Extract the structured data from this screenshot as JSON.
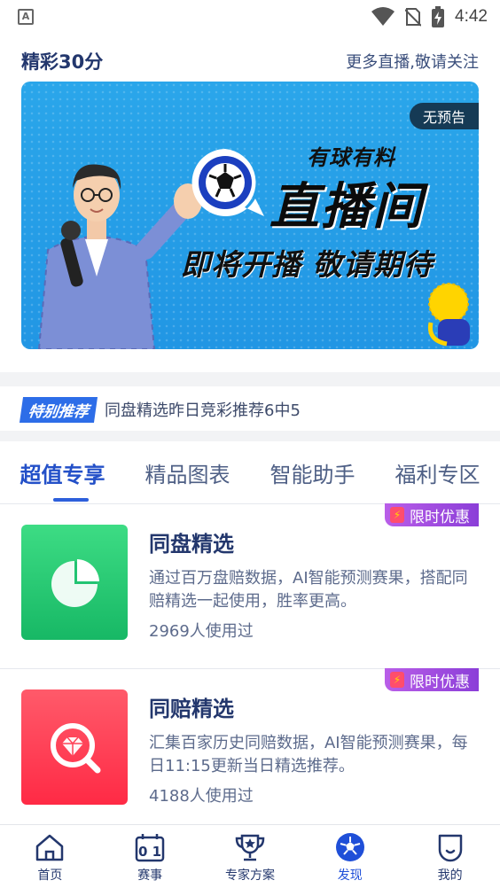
{
  "status_bar": {
    "time": "4:42",
    "app_letter": "A"
  },
  "section": {
    "title": "精彩30分",
    "link": "更多直播,敬请关注"
  },
  "banner": {
    "badge": "无预告",
    "sub_title": "有球有料",
    "main_title": "直播间",
    "tagline": "即将开播 敬请期待"
  },
  "special": {
    "tag": "特别推荐",
    "text": "同盘精选昨日竞彩推荐6中5"
  },
  "tabs": [
    {
      "label": "超值专享",
      "active": true
    },
    {
      "label": "精品图表",
      "active": false
    },
    {
      "label": "智能助手",
      "active": false
    },
    {
      "label": "福利专区",
      "active": false
    }
  ],
  "cards": [
    {
      "title": "同盘精选",
      "desc": "通过百万盘赔数据，AI智能预测赛果，搭配同赔精选一起使用，胜率更高。",
      "users": "2969人使用过",
      "promo": "限时优惠",
      "thumb_color": "#22c472",
      "icon": "pie-chart-icon"
    },
    {
      "title": "同赔精选",
      "desc": "汇集百家历史同赔数据，AI智能预测赛果，每日11:15更新当日精选推荐。",
      "users": "4188人使用过",
      "promo": "限时优惠",
      "thumb_color": "#ff3a52",
      "icon": "diamond-search-icon"
    }
  ],
  "bottom_nav": [
    {
      "label": "首页",
      "icon": "home-icon",
      "active": false
    },
    {
      "label": "赛事",
      "icon": "scoreboard-icon",
      "active": false
    },
    {
      "label": "专家方案",
      "icon": "trophy-icon",
      "active": false
    },
    {
      "label": "发现",
      "icon": "soccer-ball-icon",
      "active": true
    },
    {
      "label": "我的",
      "icon": "profile-icon",
      "active": false
    }
  ],
  "colors": {
    "accent": "#2350c8",
    "banner_bg": "#2196e4",
    "promo": "#9b4be0"
  }
}
